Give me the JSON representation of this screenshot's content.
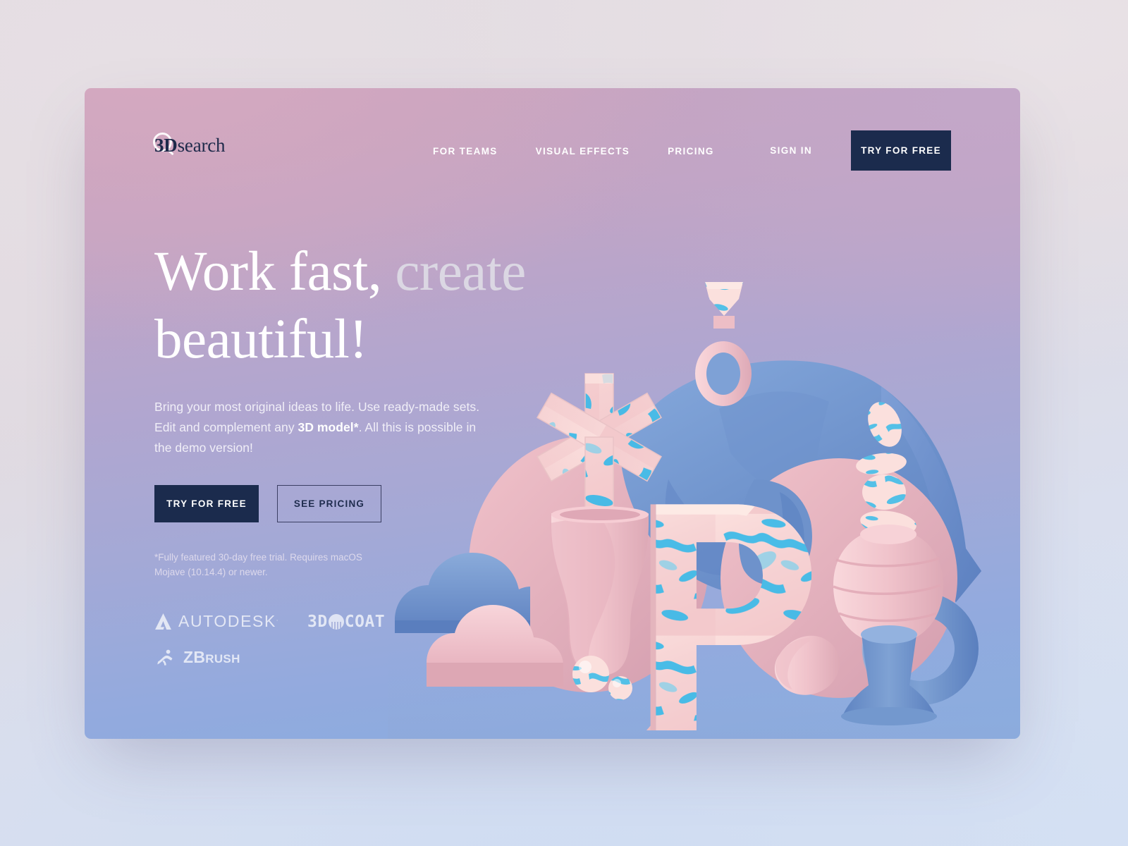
{
  "brand": {
    "mark_icon": "magnifier-icon",
    "name_bold": "3D",
    "name_light": "search"
  },
  "nav": {
    "links": [
      {
        "label": "FOR TEAMS"
      },
      {
        "label": "VISUAL EFFECTS"
      },
      {
        "label": "PRICING"
      }
    ],
    "sign_in": "SIGN IN",
    "cta": "TRY FOR FREE"
  },
  "hero": {
    "headline_bright": "Work fast, ",
    "headline_dim": "create",
    "headline_line2": "beautiful!",
    "lead_part1": "Bring your most original ideas to life. Use ready-made sets. Edit and complement any ",
    "lead_bold": "3D model*",
    "lead_part2": ". All this is possible in the demo version!",
    "btn_primary": "TRY FOR FREE",
    "btn_secondary": "SEE PRICING",
    "footnote": "*Fully featured 30-day free trial. Requires macOS Mojave (10.14.4) or newer."
  },
  "partners": [
    {
      "name": "AUTODESK",
      "icon": "autodesk-a-icon",
      "suffix": "."
    },
    {
      "name_a": "3D",
      "name_b": "COAT",
      "icon": "coat-sphere-icon"
    },
    {
      "name_a": "Z",
      "name_b": "B",
      "name_c": "RUSH",
      "icon": "zbrush-runner-icon"
    }
  ],
  "colors": {
    "navy": "#1b2b4d",
    "card_pink": "#c9a3bd",
    "card_blue": "#87ade0",
    "text_white": "#ffffff",
    "text_dim": "#dbd7e3",
    "art_pink": "#efbfc7",
    "art_blue": "#7b9fd4",
    "art_marble": "#29b6e8"
  },
  "illustration": {
    "alt": "3D render of pastel geometric objects: marbled letter P, draped blue cloth, asterisk star, pink ring with gem, stacked stones, ribbed vase on blue pedestal, blue torus, clouds and spheres"
  }
}
